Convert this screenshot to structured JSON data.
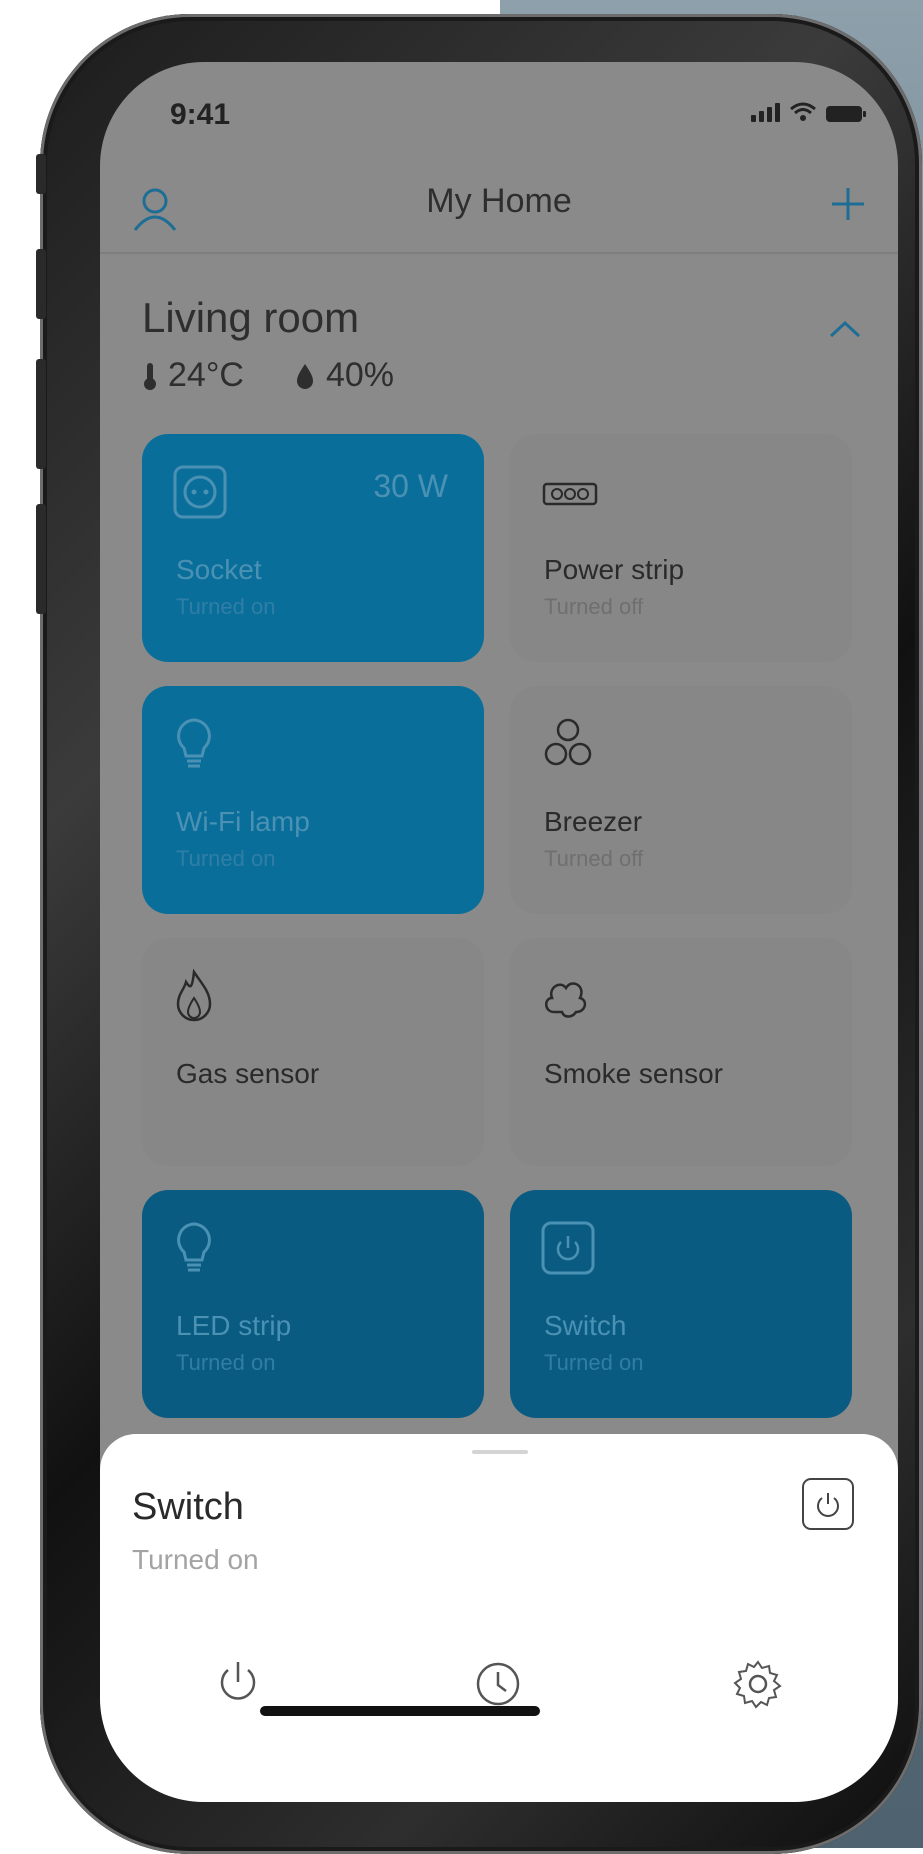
{
  "status_bar": {
    "time": "9:41"
  },
  "header": {
    "title": "My Home",
    "left_icon": "user-icon",
    "right_icon": "plus-icon"
  },
  "room": {
    "name": "Living room",
    "temperature": "24°C",
    "humidity": "40%",
    "collapse_icon": "chevron-up-icon"
  },
  "devices": [
    {
      "name": "Socket",
      "status": "Turned on",
      "power": "30 W",
      "icon": "socket-icon",
      "state": "on"
    },
    {
      "name": "Power strip",
      "status": "Turned off",
      "icon": "power-strip-icon",
      "state": "off"
    },
    {
      "name": "Wi-Fi  lamp",
      "status": "Turned on",
      "icon": "bulb-icon",
      "state": "on"
    },
    {
      "name": "Breezer",
      "status": "Turned off",
      "icon": "fan-icon",
      "state": "off"
    },
    {
      "name": "Gas sensor",
      "icon": "flame-icon",
      "state": "off"
    },
    {
      "name": "Smoke sensor",
      "icon": "cloud-icon",
      "state": "off"
    },
    {
      "name": "LED strip",
      "status": "Turned on",
      "icon": "bulb-icon",
      "state": "on"
    },
    {
      "name": "Switch",
      "status": "Turned on",
      "icon": "switch-icon",
      "state": "on"
    }
  ],
  "sheet": {
    "title": "Switch",
    "status": "Turned on",
    "actions": [
      "power-icon",
      "clock-icon",
      "gear-icon"
    ]
  },
  "colors": {
    "accent": "#0a6e9b",
    "overlay_gray": "#8a8a8a",
    "sheet_bg": "#ffffff"
  }
}
